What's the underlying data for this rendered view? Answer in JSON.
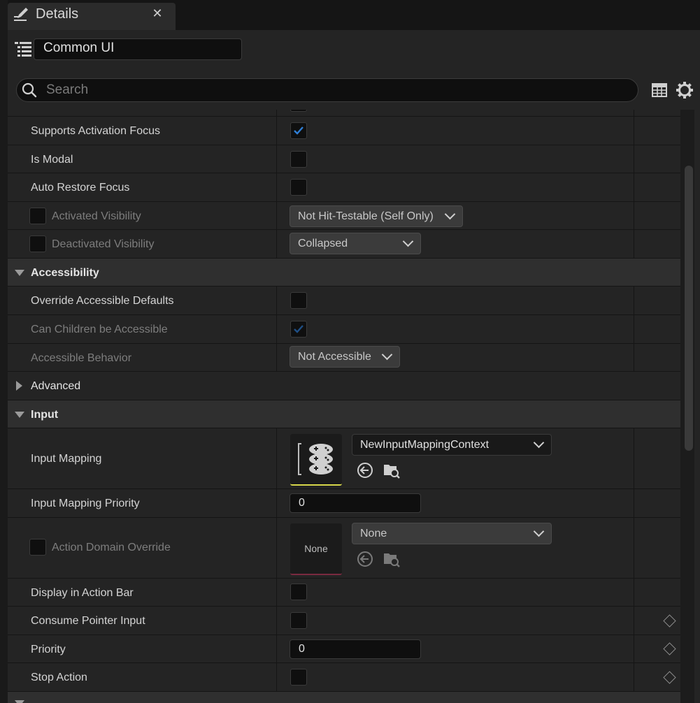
{
  "tab": {
    "title": "Details",
    "close_glyph": "✕",
    "icon": "pencil-edit-icon"
  },
  "object": {
    "name": "Common UI",
    "icon": "hierarchy-list-icon"
  },
  "search": {
    "placeholder": "Search",
    "value": ""
  },
  "toolbar": {
    "table_icon": "table-grid-icon",
    "settings_icon": "gear-icon"
  },
  "rows": {
    "supports_activation_focus": {
      "label": "Supports Activation Focus",
      "checked": true
    },
    "is_modal": {
      "label": "Is Modal",
      "checked": false
    },
    "auto_restore_focus": {
      "label": "Auto Restore Focus",
      "checked": false
    },
    "activated_visibility": {
      "label": "Activated Visibility",
      "value": "Not Hit-Testable (Self Only)",
      "override": false
    },
    "deactivated_visibility": {
      "label": "Deactivated Visibility",
      "value": "Collapsed",
      "override": false
    },
    "accessibility": {
      "label": "Accessibility",
      "expanded": true
    },
    "override_accessible_defaults": {
      "label": "Override Accessible Defaults",
      "checked": false
    },
    "can_children_be_accessible": {
      "label": "Can Children be Accessible",
      "checked": true
    },
    "accessible_behavior": {
      "label": "Accessible Behavior",
      "value": "Not Accessible"
    },
    "advanced": {
      "label": "Advanced",
      "expanded": false
    },
    "input": {
      "label": "Input",
      "expanded": true
    },
    "input_mapping": {
      "label": "Input Mapping",
      "value": "NewInputMappingContext"
    },
    "input_mapping_priority": {
      "label": "Input Mapping Priority",
      "value": "0"
    },
    "action_domain_override": {
      "label": "Action Domain Override",
      "value": "None",
      "thumb_text": "None",
      "override": false
    },
    "display_in_action_bar": {
      "label": "Display in Action Bar",
      "checked": false
    },
    "consume_pointer_input": {
      "label": "Consume Pointer Input",
      "checked": false
    },
    "priority": {
      "label": "Priority",
      "value": "0"
    },
    "stop_action": {
      "label": "Stop Action",
      "checked": false
    }
  },
  "colors": {
    "accent_check": "#2f7fd6",
    "panel_bg": "#242424",
    "category_bg": "#2f2f2f",
    "asset_underline": "#d6d64a",
    "none_underline": "#7a2a40"
  }
}
